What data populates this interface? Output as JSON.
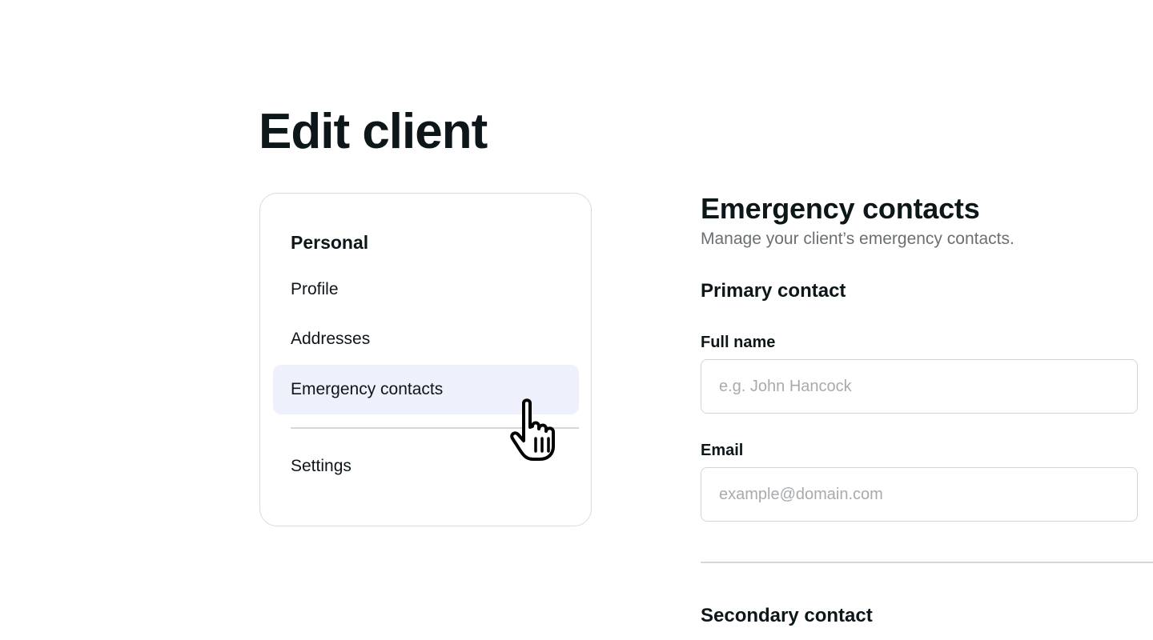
{
  "page": {
    "title": "Edit client"
  },
  "sidebar": {
    "section_title": "Personal",
    "items": [
      {
        "label": "Profile",
        "active": false
      },
      {
        "label": "Addresses",
        "active": false
      },
      {
        "label": "Emergency contacts",
        "active": true
      }
    ],
    "footer_items": [
      {
        "label": "Settings"
      }
    ]
  },
  "main": {
    "title": "Emergency contacts",
    "subtitle": "Manage your client’s emergency contacts.",
    "primary": {
      "heading": "Primary contact",
      "full_name": {
        "label": "Full name",
        "value": "",
        "placeholder": "e.g. John Hancock"
      },
      "email": {
        "label": "Email",
        "value": "",
        "placeholder": "example@domain.com"
      }
    },
    "secondary": {
      "heading": "Secondary contact"
    }
  },
  "colors": {
    "text": "#0d1619",
    "muted": "#6b6f72",
    "active_bg": "#eef0fb",
    "border": "#dcdcdc"
  },
  "icons": {
    "cursor": "hand-pointer-icon"
  }
}
